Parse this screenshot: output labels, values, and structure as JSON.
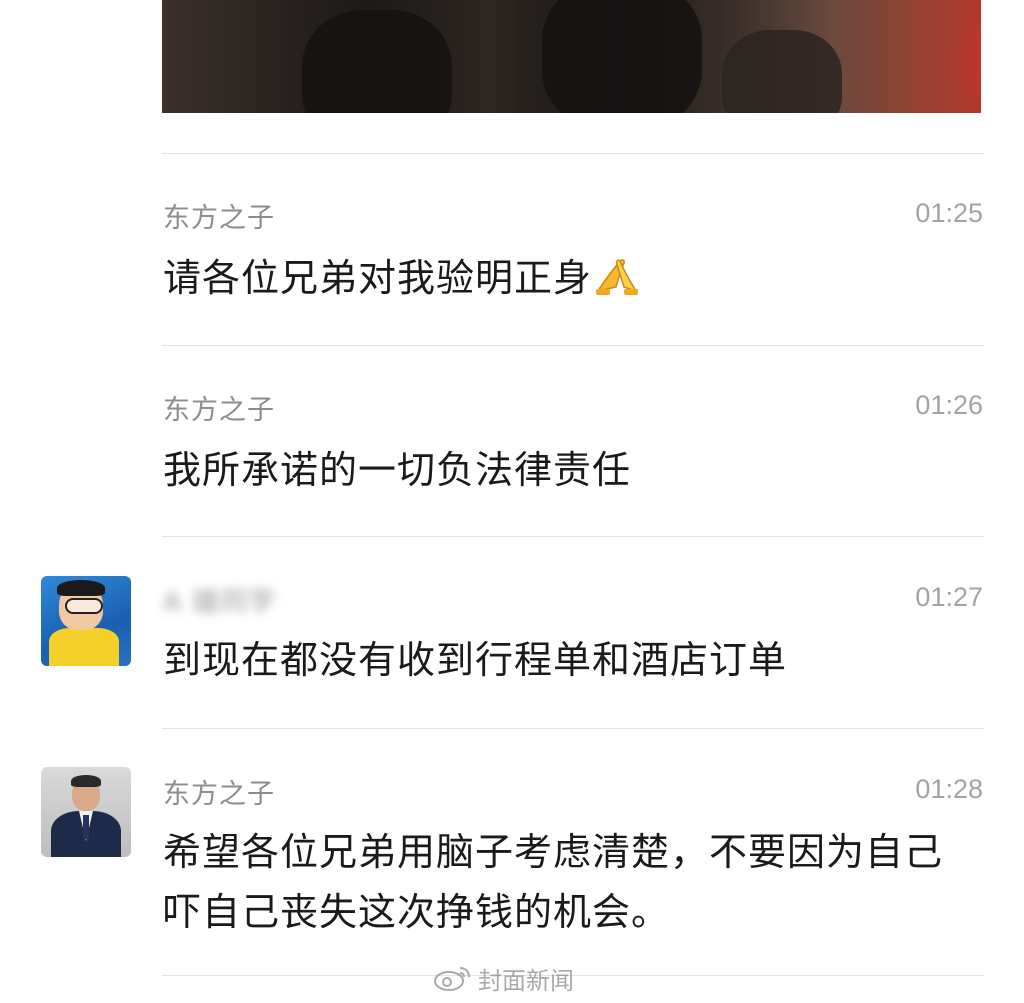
{
  "chat": {
    "messages": [
      {
        "sender": "东方之子",
        "time": "01:25",
        "text": "请各位兄弟对我验明正身",
        "emoji": "folded-hands-emoji",
        "avatar": null
      },
      {
        "sender": "东方之子",
        "time": "01:26",
        "text": "我所承诺的一切负法律责任",
        "avatar": null
      },
      {
        "sender": "A 雄同学",
        "time": "01:27",
        "text": "到现在都没有收到行程单和酒店订单",
        "avatar": "cartoon-boy-avatar"
      },
      {
        "sender": "东方之子",
        "time": "01:28",
        "text": "希望各位兄弟用脑子考虑清楚，不要因为自己吓自己丧失这次挣钱的机会。",
        "avatar": "man-in-suit-avatar"
      }
    ]
  },
  "watermark": {
    "text": "封面新闻",
    "icon": "weibo-icon"
  },
  "colors": {
    "name": "#8c8c8c",
    "time": "#a3a3a3",
    "text": "#1a1a1a",
    "divider": "#e4e4e4"
  }
}
